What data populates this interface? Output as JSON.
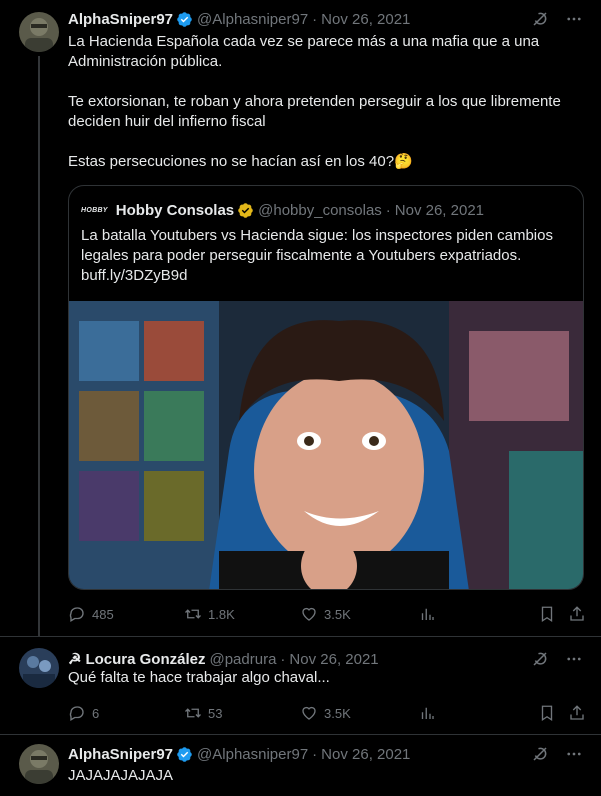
{
  "tweets": [
    {
      "name": "AlphaSniper97",
      "handle": "@Alphasniper97",
      "date": "Nov 26, 2021",
      "text": "La Hacienda Española cada vez se parece más a una mafia que a una\nAdministración pública.\n\nTe extorsionan, te roban y ahora pretenden perseguir a los que libremente\ndeciden huir del infierno fiscal\n\nEstas persecuciones no se hacían así en los 40?🤔",
      "replies": "485",
      "retweets": "1.8K",
      "likes": "3.5K"
    },
    {
      "name": "Locura González",
      "name_prefix": "☭",
      "handle": "@padrura",
      "date": "Nov 26, 2021",
      "text": "Qué falta te hace trabajar algo chaval...",
      "replies": "6",
      "retweets": "53",
      "likes": "3.5K"
    },
    {
      "name": "AlphaSniper97",
      "handle": "@Alphasniper97",
      "date": "Nov 26, 2021",
      "text": "JAJAJAJAJAJA"
    }
  ],
  "quote": {
    "logo": "HOBBY",
    "name": "Hobby Consolas",
    "handle": "@hobby_consolas",
    "date": "Nov 26, 2021",
    "text": "La batalla Youtubers vs Hacienda sigue: los inspectores piden cambios\nlegales para poder perseguir fiscalmente a Youtubers expatriados.\nbuff.ly/3DZyB9d"
  },
  "separator": "·",
  "colors": {
    "background": "#000000",
    "text": "#e7e9ea",
    "muted": "#71767b",
    "verified_blue": "#1d9bf0",
    "verified_gold": "#e2b719",
    "border": "#2f3336"
  },
  "icons": [
    "grok-icon",
    "more-icon",
    "reply-icon",
    "retweet-icon",
    "like-icon",
    "views-icon",
    "bookmark-icon",
    "share-icon",
    "verified-badge-icon"
  ]
}
